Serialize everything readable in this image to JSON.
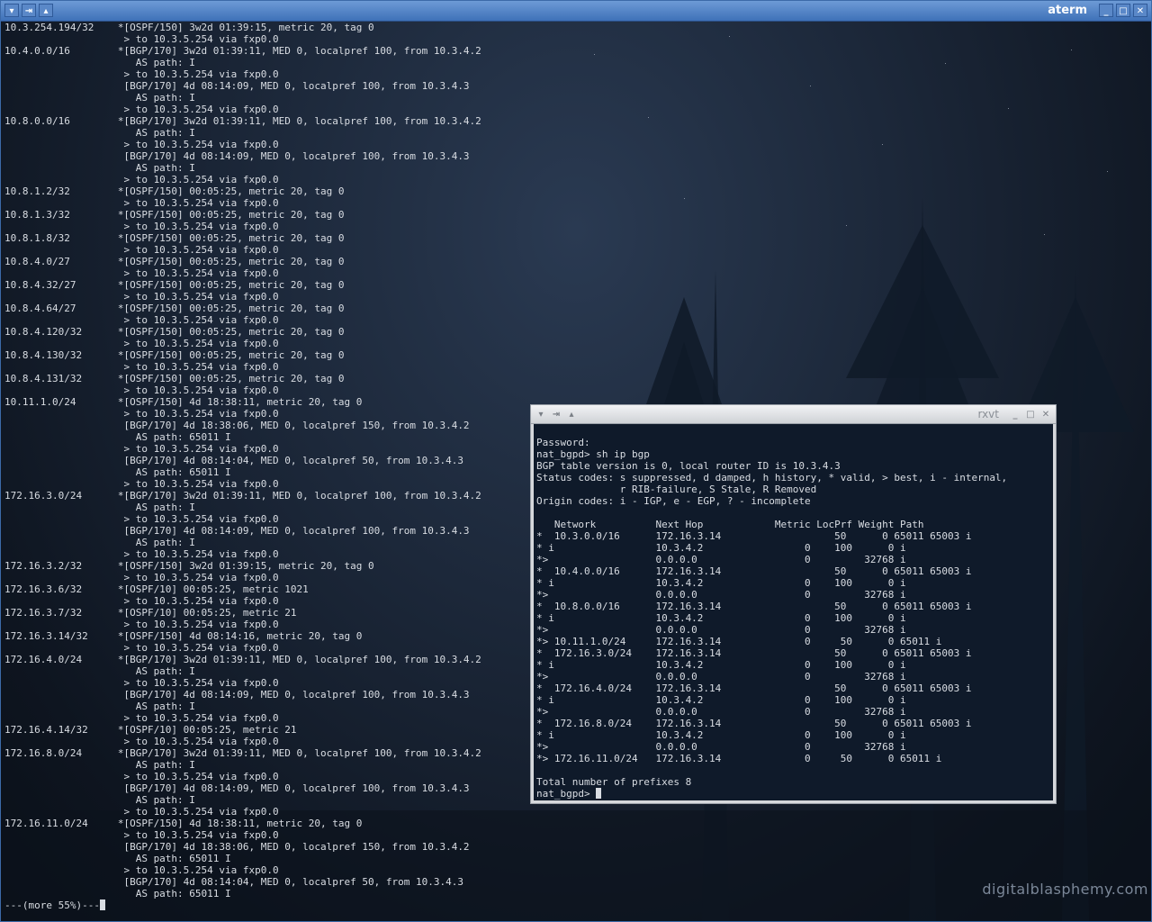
{
  "aterm": {
    "title": "aterm",
    "lines": [
      "10.3.254.194/32    *[OSPF/150] 3w2d 01:39:15, metric 20, tag 0",
      "                    > to 10.3.5.254 via fxp0.0",
      "10.4.0.0/16        *[BGP/170] 3w2d 01:39:11, MED 0, localpref 100, from 10.3.4.2",
      "                      AS path: I",
      "                    > to 10.3.5.254 via fxp0.0",
      "                    [BGP/170] 4d 08:14:09, MED 0, localpref 100, from 10.3.4.3",
      "                      AS path: I",
      "                    > to 10.3.5.254 via fxp0.0",
      "10.8.0.0/16        *[BGP/170] 3w2d 01:39:11, MED 0, localpref 100, from 10.3.4.2",
      "                      AS path: I",
      "                    > to 10.3.5.254 via fxp0.0",
      "                    [BGP/170] 4d 08:14:09, MED 0, localpref 100, from 10.3.4.3",
      "                      AS path: I",
      "                    > to 10.3.5.254 via fxp0.0",
      "10.8.1.2/32        *[OSPF/150] 00:05:25, metric 20, tag 0",
      "                    > to 10.3.5.254 via fxp0.0",
      "10.8.1.3/32        *[OSPF/150] 00:05:25, metric 20, tag 0",
      "                    > to 10.3.5.254 via fxp0.0",
      "10.8.1.8/32        *[OSPF/150] 00:05:25, metric 20, tag 0",
      "                    > to 10.3.5.254 via fxp0.0",
      "10.8.4.0/27        *[OSPF/150] 00:05:25, metric 20, tag 0",
      "                    > to 10.3.5.254 via fxp0.0",
      "10.8.4.32/27       *[OSPF/150] 00:05:25, metric 20, tag 0",
      "                    > to 10.3.5.254 via fxp0.0",
      "10.8.4.64/27       *[OSPF/150] 00:05:25, metric 20, tag 0",
      "                    > to 10.3.5.254 via fxp0.0",
      "10.8.4.120/32      *[OSPF/150] 00:05:25, metric 20, tag 0",
      "                    > to 10.3.5.254 via fxp0.0",
      "10.8.4.130/32      *[OSPF/150] 00:05:25, metric 20, tag 0",
      "                    > to 10.3.5.254 via fxp0.0",
      "10.8.4.131/32      *[OSPF/150] 00:05:25, metric 20, tag 0",
      "                    > to 10.3.5.254 via fxp0.0",
      "10.11.1.0/24       *[OSPF/150] 4d 18:38:11, metric 20, tag 0",
      "                    > to 10.3.5.254 via fxp0.0",
      "                    [BGP/170] 4d 18:38:06, MED 0, localpref 150, from 10.3.4.2",
      "                      AS path: 65011 I",
      "                    > to 10.3.5.254 via fxp0.0",
      "                    [BGP/170] 4d 08:14:04, MED 0, localpref 50, from 10.3.4.3",
      "                      AS path: 65011 I",
      "                    > to 10.3.5.254 via fxp0.0",
      "172.16.3.0/24      *[BGP/170] 3w2d 01:39:11, MED 0, localpref 100, from 10.3.4.2",
      "                      AS path: I",
      "                    > to 10.3.5.254 via fxp0.0",
      "                    [BGP/170] 4d 08:14:09, MED 0, localpref 100, from 10.3.4.3",
      "                      AS path: I",
      "                    > to 10.3.5.254 via fxp0.0",
      "172.16.3.2/32      *[OSPF/150] 3w2d 01:39:15, metric 20, tag 0",
      "                    > to 10.3.5.254 via fxp0.0",
      "172.16.3.6/32      *[OSPF/10] 00:05:25, metric 1021",
      "                    > to 10.3.5.254 via fxp0.0",
      "172.16.3.7/32      *[OSPF/10] 00:05:25, metric 21",
      "                    > to 10.3.5.254 via fxp0.0",
      "172.16.3.14/32     *[OSPF/150] 4d 08:14:16, metric 20, tag 0",
      "                    > to 10.3.5.254 via fxp0.0",
      "172.16.4.0/24      *[BGP/170] 3w2d 01:39:11, MED 0, localpref 100, from 10.3.4.2",
      "                      AS path: I",
      "                    > to 10.3.5.254 via fxp0.0",
      "                    [BGP/170] 4d 08:14:09, MED 0, localpref 100, from 10.3.4.3",
      "                      AS path: I",
      "                    > to 10.3.5.254 via fxp0.0",
      "172.16.4.14/32     *[OSPF/10] 00:05:25, metric 21",
      "                    > to 10.3.5.254 via fxp0.0",
      "172.16.8.0/24      *[BGP/170] 3w2d 01:39:11, MED 0, localpref 100, from 10.3.4.2",
      "                      AS path: I",
      "                    > to 10.3.5.254 via fxp0.0",
      "                    [BGP/170] 4d 08:14:09, MED 0, localpref 100, from 10.3.4.3",
      "                      AS path: I",
      "                    > to 10.3.5.254 via fxp0.0",
      "172.16.11.0/24     *[OSPF/150] 4d 18:38:11, metric 20, tag 0",
      "                    > to 10.3.5.254 via fxp0.0",
      "                    [BGP/170] 4d 18:38:06, MED 0, localpref 150, from 10.3.4.2",
      "                      AS path: 65011 I",
      "                    > to 10.3.5.254 via fxp0.0",
      "                    [BGP/170] 4d 08:14:04, MED 0, localpref 50, from 10.3.4.3",
      "                      AS path: 65011 I"
    ],
    "pager": "---(more 55%)---"
  },
  "rxvt": {
    "title": "rxvt",
    "lines": [
      "Password:",
      "nat_bgpd> sh ip bgp",
      "BGP table version is 0, local router ID is 10.3.4.3",
      "Status codes: s suppressed, d damped, h history, * valid, > best, i - internal,",
      "              r RIB-failure, S Stale, R Removed",
      "Origin codes: i - IGP, e - EGP, ? - incomplete",
      "",
      "   Network          Next Hop            Metric LocPrf Weight Path",
      "*  10.3.0.0/16      172.16.3.14                   50      0 65011 65003 i",
      "* i                 10.3.4.2                 0    100      0 i",
      "*>                  0.0.0.0                  0         32768 i",
      "*  10.4.0.0/16      172.16.3.14                   50      0 65011 65003 i",
      "* i                 10.3.4.2                 0    100      0 i",
      "*>                  0.0.0.0                  0         32768 i",
      "*  10.8.0.0/16      172.16.3.14                   50      0 65011 65003 i",
      "* i                 10.3.4.2                 0    100      0 i",
      "*>                  0.0.0.0                  0         32768 i",
      "*> 10.11.1.0/24     172.16.3.14              0     50      0 65011 i",
      "*  172.16.3.0/24    172.16.3.14                   50      0 65011 65003 i",
      "* i                 10.3.4.2                 0    100      0 i",
      "*>                  0.0.0.0                  0         32768 i",
      "*  172.16.4.0/24    172.16.3.14                   50      0 65011 65003 i",
      "* i                 10.3.4.2                 0    100      0 i",
      "*>                  0.0.0.0                  0         32768 i",
      "*  172.16.8.0/24    172.16.3.14                   50      0 65011 65003 i",
      "* i                 10.3.4.2                 0    100      0 i",
      "*>                  0.0.0.0                  0         32768 i",
      "*> 172.16.11.0/24   172.16.3.14              0     50      0 65011 i",
      "",
      "Total number of prefixes 8"
    ],
    "prompt": "nat_bgpd> "
  },
  "watermark": "digitalblasphemy.com"
}
